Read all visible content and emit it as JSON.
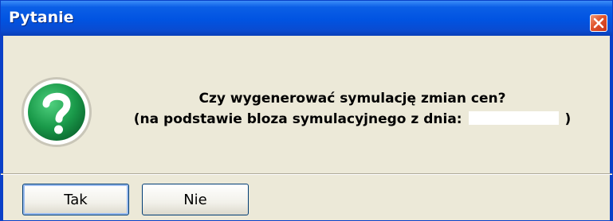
{
  "window": {
    "title": "Pytanie"
  },
  "icons": {
    "question": "question-icon",
    "close": "close-icon"
  },
  "message": {
    "line1": "Czy wygenerować symulację zmian cen?",
    "line2_prefix": "(na podstawie bloza symulacyjnego z dnia:",
    "line2_suffix": ")"
  },
  "buttons": {
    "yes": "Tak",
    "no": "Nie"
  },
  "colors": {
    "titlebar": "#0153e1",
    "close_button": "#e0532a",
    "dialog_background": "#ece9d8",
    "icon_green": "#1a9a4a"
  }
}
